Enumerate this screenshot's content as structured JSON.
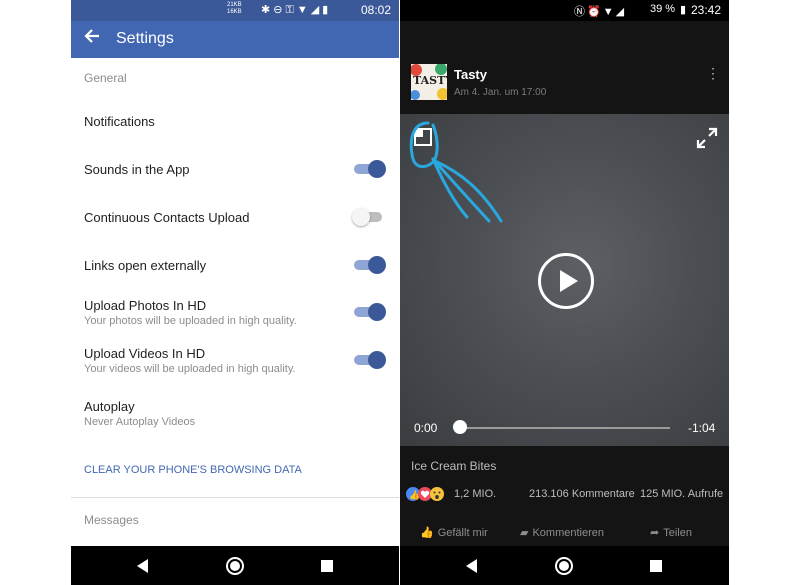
{
  "left_phone": {
    "status_bar": {
      "data_rate_top": "21KB",
      "data_rate_bottom": "16KB",
      "time": "08:02"
    },
    "header": {
      "title": "Settings"
    },
    "sections": {
      "general": "General",
      "messages": "Messages"
    },
    "settings": [
      {
        "label": "Notifications",
        "sublabel": "",
        "toggle": null
      },
      {
        "label": "Sounds in the App",
        "sublabel": "",
        "toggle": "on"
      },
      {
        "label": "Continuous Contacts Upload",
        "sublabel": "",
        "toggle": "off"
      },
      {
        "label": "Links open externally",
        "sublabel": "",
        "toggle": "on"
      },
      {
        "label": "Upload Photos In HD",
        "sublabel": "Your photos will be uploaded in high quality.",
        "toggle": "on"
      },
      {
        "label": "Upload Videos In HD",
        "sublabel": "Your videos will be uploaded in high quality.",
        "toggle": "on"
      },
      {
        "label": "Autoplay",
        "sublabel": "Never Autoplay Videos",
        "toggle": null
      }
    ],
    "clear_data_link": "CLEAR YOUR PHONE'S BROWSING DATA",
    "colors": {
      "facebook_blue": "#4267b2",
      "status_blue": "#3b5998"
    }
  },
  "right_phone": {
    "status_bar": {
      "battery": "39 %",
      "time": "23:42"
    },
    "post": {
      "page_logo_text": "TASTY",
      "page_name": "Tasty",
      "date": "Am 4. Jan. um 17:00"
    },
    "player": {
      "time_current": "0:00",
      "time_remaining": "-1:04",
      "progress": 0.0
    },
    "video_title": "Ice Cream Bites",
    "stats": {
      "reactions": "1,2 MIO.",
      "comments": "213.106 Kommentare",
      "views": "125 MIO. Aufrufe"
    },
    "actions": {
      "like": "Gefällt mir",
      "comment": "Kommentieren",
      "share": "Teilen"
    },
    "annotation_color": "#29a8e0"
  }
}
